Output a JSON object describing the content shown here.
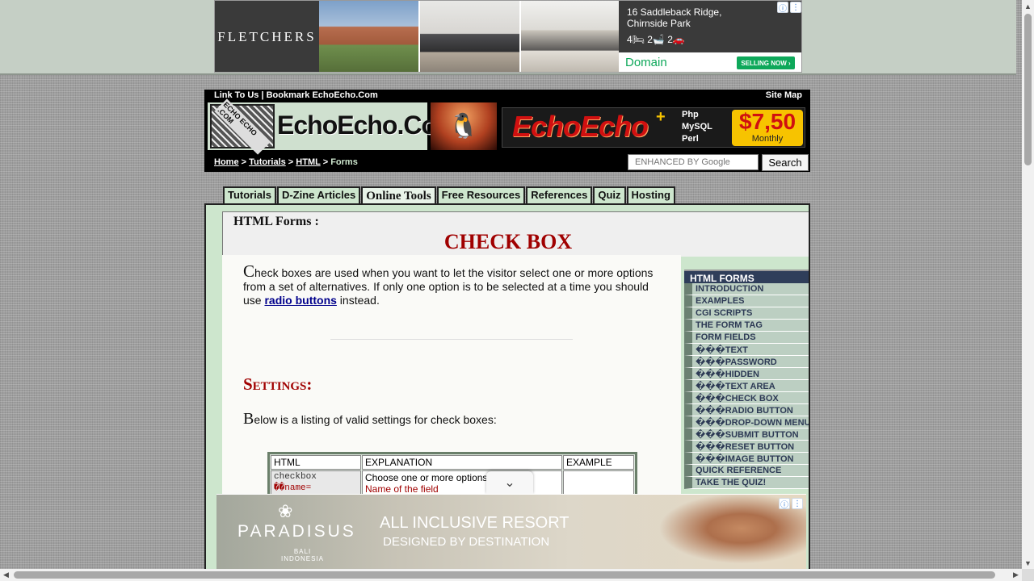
{
  "top_ad": {
    "brand": "FLETCHERS",
    "address_line1": "16 Saddleback Ridge,",
    "address_line2": "Chirnside Park",
    "beds": "4🛏  2🛁  2🚗",
    "network": "Domain",
    "cta": "SELLING NOW ›",
    "info_icon": "ⓘ",
    "menu_icon": "⋮"
  },
  "header": {
    "top_links": "Link To Us | Bookmark EchoEcho.Com",
    "site_map": "Site Map",
    "logo_text": "EchoEcho.Com",
    "logo_badge": "ECHO ECHO .COM",
    "hosting": {
      "brand": "EchoEcho",
      "plus": "+",
      "lang1": "Php",
      "lang2": "MySQL",
      "lang3": "Perl",
      "price": "$7,50",
      "period": "Monthly"
    },
    "breadcrumb": {
      "home": "Home",
      "sep": " > ",
      "tutorials": "Tutorials",
      "html": "HTML",
      "current": "Forms"
    },
    "search": {
      "placeholder": "ENHANCED BY Google",
      "button": "Search"
    }
  },
  "tabs": [
    {
      "label": "Tutorials"
    },
    {
      "label": "D-Zine Articles"
    },
    {
      "label": "Online Tools"
    },
    {
      "label": "Free Resources"
    },
    {
      "label": "References"
    },
    {
      "label": "Quiz"
    },
    {
      "label": "Hosting"
    }
  ],
  "page": {
    "section_label": "HTML Forms :",
    "title": "CHECK BOX",
    "intro": {
      "dropcap": "C",
      "text_before": "heck boxes are used when you want to let the visitor select one or more options from a set of alternatives. If only one option is to be selected at a time you should use ",
      "link": "radio buttons",
      "text_after": " instead."
    },
    "settings_heading": "Settings:",
    "settings_intro_dropcap": "B",
    "settings_intro": "elow is a listing of valid settings for check boxes:",
    "table": {
      "headers": [
        "HTML",
        "EXPLANATION",
        "EXAMPLE"
      ],
      "row1_code": "checkbox",
      "row1_expl": "Choose one or more options",
      "row2_code": "��name=",
      "row2_expl": "Name of the field"
    }
  },
  "side_nav": {
    "heading": "HTML FORMS",
    "items": [
      "INTRODUCTION",
      "EXAMPLES",
      "CGI SCRIPTS",
      "THE FORM TAG",
      "FORM FIELDS",
      "���TEXT",
      "���PASSWORD",
      "���HIDDEN",
      "���TEXT AREA",
      "���CHECK BOX",
      "���RADIO BUTTON",
      "���DROP-DOWN MENU",
      "���SUBMIT BUTTON",
      "���RESET BUTTON",
      "���IMAGE BUTTON",
      "QUICK REFERENCE",
      "TAKE THE QUIZ!"
    ]
  },
  "bottom_ad": {
    "brand": "PARADISUS",
    "brand_sub1": "BALI",
    "brand_sub2": "INDONESIA",
    "line1": "ALL INCLUSIVE RESORT",
    "line2": "DESIGNED BY DESTINATION",
    "collapse_icon": "⌄",
    "info_icon": "ⓘ",
    "menu_icon": "⋮"
  },
  "scrollbars": {
    "up": "▲",
    "down": "▼",
    "left": "◀",
    "right": "▶"
  }
}
